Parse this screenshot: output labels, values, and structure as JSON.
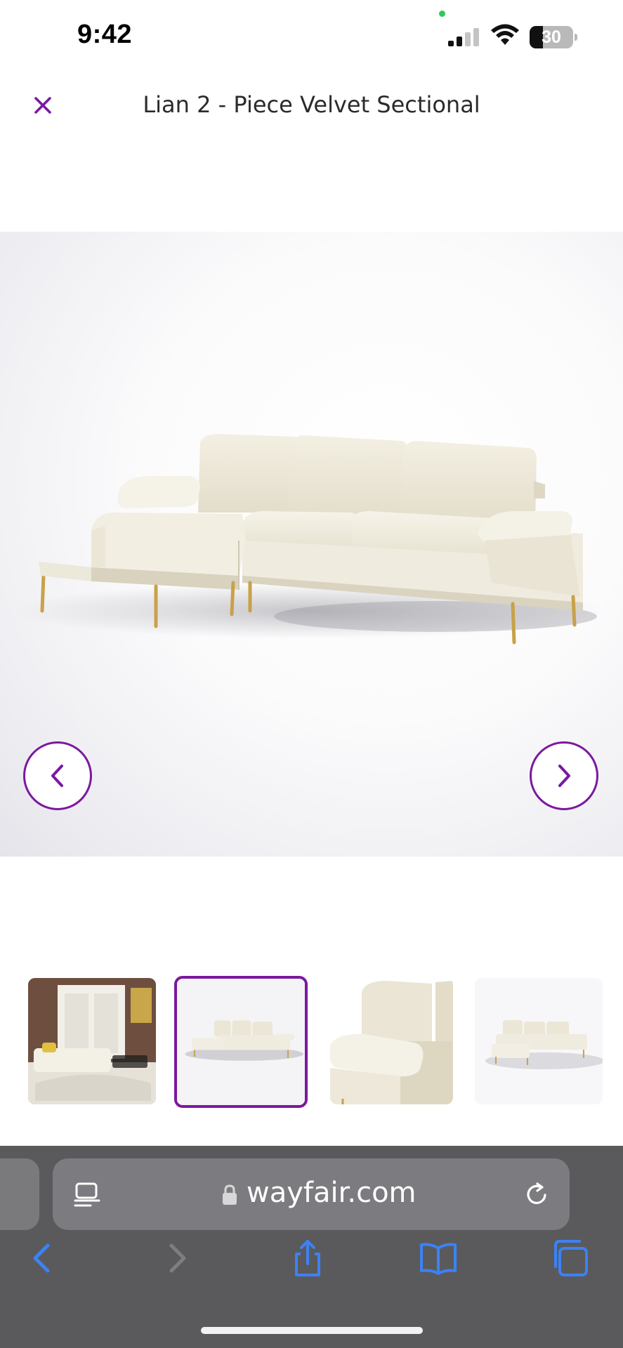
{
  "status_bar": {
    "time": "9:42",
    "battery_level": "30",
    "battery_fraction": 0.3,
    "icons": [
      "signal-icon",
      "wifi-icon",
      "battery-icon"
    ]
  },
  "header": {
    "close_icon": "close-icon",
    "title": "Lian 2 - Piece Velvet Sectional"
  },
  "gallery": {
    "prev_icon": "chevron-left-icon",
    "next_icon": "chevron-right-icon",
    "selected_index": 1,
    "thumbnails": [
      "room-scene",
      "sectional-front",
      "cushion-closeup",
      "sectional-angle"
    ]
  },
  "browser": {
    "url": "wayfair.com",
    "toolbar": [
      "back-icon",
      "forward-icon",
      "share-icon",
      "bookmarks-icon",
      "tabs-icon"
    ]
  },
  "colors": {
    "accent": "#7b189f",
    "sofa": "#f1ede0",
    "legs": "#c9a14a",
    "browser_link": "#3b82f6"
  }
}
